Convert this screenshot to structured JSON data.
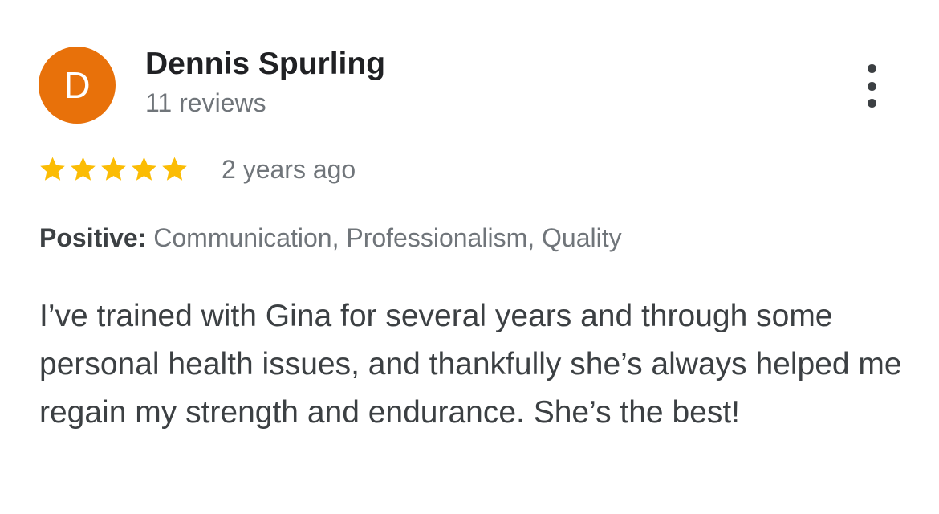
{
  "reviewer": {
    "initial": "D",
    "avatar_color": "#e8710a",
    "name": "Dennis Spurling",
    "review_count": "11 reviews"
  },
  "menu": {
    "icon": "more-vert-icon"
  },
  "rating": {
    "stars": 5,
    "max_stars": 5,
    "star_color": "#fbbc04",
    "time_ago": "2 years ago"
  },
  "attributes": {
    "label": "Positive:",
    "values": "Communication, Professionalism, Quality"
  },
  "review_text": "I’ve trained with Gina for several years and through some personal health issues, and thankfully she’s always helped me regain my strength and endurance. She’s the best!"
}
